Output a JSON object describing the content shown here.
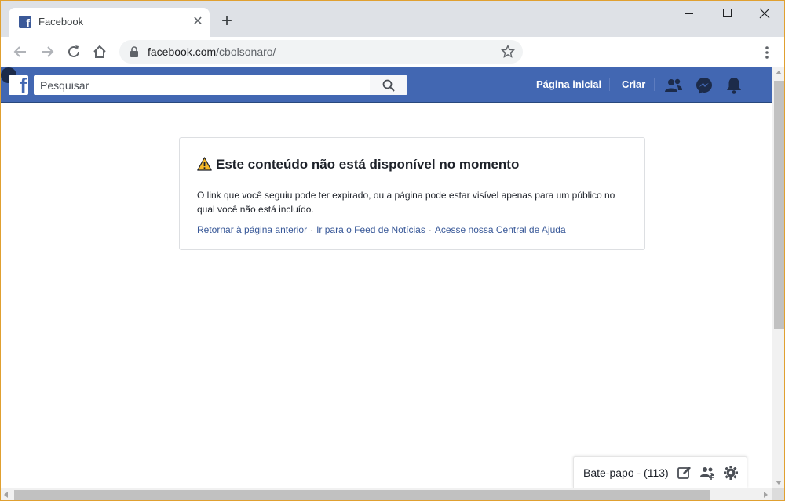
{
  "browser": {
    "tab_title": "Facebook",
    "new_tab_symbol": "+",
    "close_symbol": "✕",
    "url_host": "facebook.com",
    "url_path": "/cbolsonaro/"
  },
  "fbbar": {
    "search_placeholder": "Pesquisar",
    "home_label": "Página inicial",
    "create_label": "Criar",
    "logo_letter": "f"
  },
  "error": {
    "title": "Este conteúdo não está disponível no momento",
    "body": "O link que você seguiu pode ter expirado, ou a página pode estar visível apenas para um público no qual você não está incluído.",
    "links": {
      "back": "Retornar à página anterior",
      "feed": "Ir para o Feed de Notícias",
      "help": "Acesse nossa Central de Ajuda"
    },
    "separator": "·"
  },
  "chat": {
    "label": "Bate-papo - (113)"
  },
  "colors": {
    "facebook_blue": "#4267b2",
    "link_blue": "#385898",
    "warning_yellow": "#f7b928"
  }
}
